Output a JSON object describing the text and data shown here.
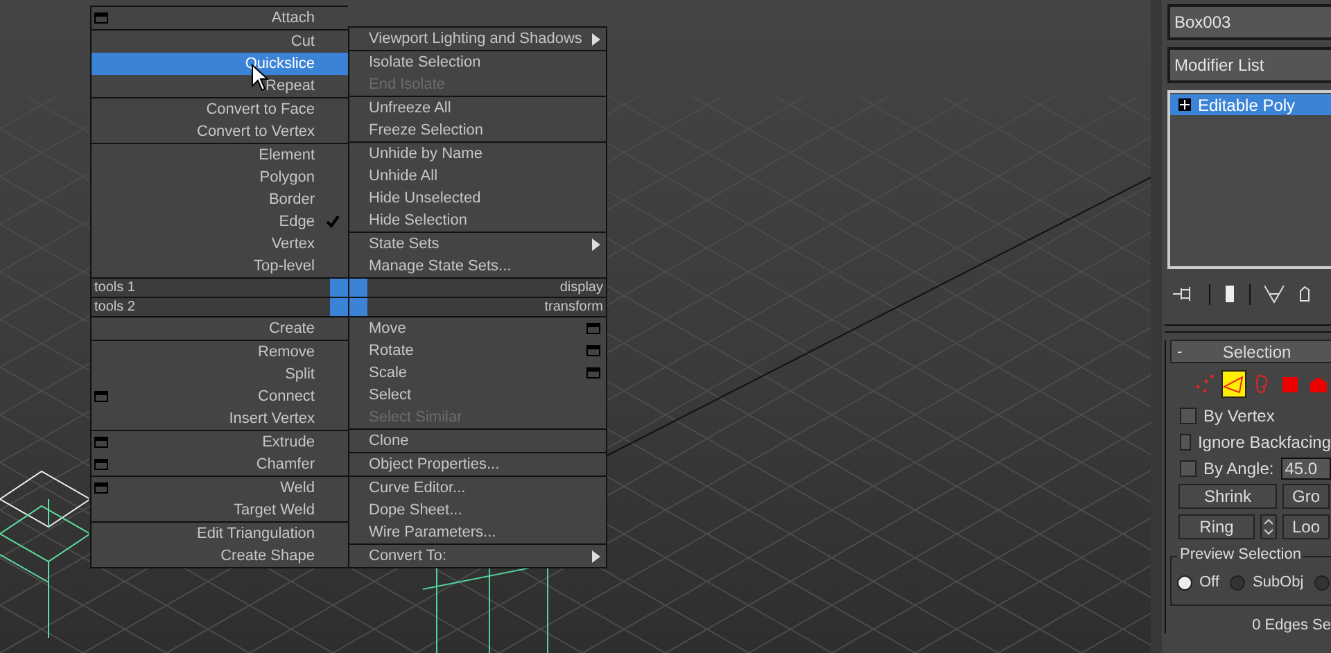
{
  "quad_menu": {
    "left": {
      "top_groups": [
        [
          {
            "label": "Attach",
            "kind": "options",
            "selected": false,
            "disabled": false,
            "checked": false
          }
        ],
        [
          {
            "label": "Cut",
            "kind": "command",
            "selected": false,
            "disabled": false,
            "checked": false
          },
          {
            "label": "Quickslice",
            "kind": "command",
            "selected": true,
            "disabled": false,
            "checked": false
          },
          {
            "label": "Repeat",
            "kind": "command",
            "selected": false,
            "disabled": false,
            "checked": false
          }
        ],
        [
          {
            "label": "Convert to Face",
            "kind": "command",
            "selected": false,
            "disabled": false,
            "checked": false
          },
          {
            "label": "Convert to Vertex",
            "kind": "command",
            "selected": false,
            "disabled": false,
            "checked": false
          }
        ],
        [
          {
            "label": "Element",
            "kind": "command",
            "selected": false,
            "disabled": false,
            "checked": false
          },
          {
            "label": "Polygon",
            "kind": "command",
            "selected": false,
            "disabled": false,
            "checked": false
          },
          {
            "label": "Border",
            "kind": "command",
            "selected": false,
            "disabled": false,
            "checked": false
          },
          {
            "label": "Edge",
            "kind": "command",
            "selected": false,
            "disabled": false,
            "checked": true
          },
          {
            "label": "Vertex",
            "kind": "command",
            "selected": false,
            "disabled": false,
            "checked": false
          },
          {
            "label": "Top-level",
            "kind": "command",
            "selected": false,
            "disabled": false,
            "checked": false
          }
        ]
      ],
      "headers": [
        {
          "label": "tools 1"
        },
        {
          "label": "tools 2"
        }
      ],
      "bottom_groups": [
        [
          {
            "label": "Create",
            "kind": "command",
            "selected": false,
            "disabled": false,
            "checked": false
          }
        ],
        [
          {
            "label": "Remove",
            "kind": "command",
            "selected": false,
            "disabled": false,
            "checked": false
          },
          {
            "label": "Split",
            "kind": "command",
            "selected": false,
            "disabled": false,
            "checked": false
          },
          {
            "label": "Connect",
            "kind": "options",
            "selected": false,
            "disabled": false,
            "checked": false
          },
          {
            "label": "Insert Vertex",
            "kind": "command",
            "selected": false,
            "disabled": false,
            "checked": false
          }
        ],
        [
          {
            "label": "Extrude",
            "kind": "options",
            "selected": false,
            "disabled": false,
            "checked": false
          },
          {
            "label": "Chamfer",
            "kind": "options",
            "selected": false,
            "disabled": false,
            "checked": false
          }
        ],
        [
          {
            "label": "Weld",
            "kind": "options",
            "selected": false,
            "disabled": false,
            "checked": false
          },
          {
            "label": "Target Weld",
            "kind": "command",
            "selected": false,
            "disabled": false,
            "checked": false
          }
        ],
        [
          {
            "label": "Edit Triangulation",
            "kind": "command",
            "selected": false,
            "disabled": false,
            "checked": false
          },
          {
            "label": "Create Shape",
            "kind": "command",
            "selected": false,
            "disabled": false,
            "checked": false
          }
        ]
      ]
    },
    "right": {
      "top_groups": [
        [
          {
            "label": "Viewport Lighting and Shadows",
            "kind": "submenu",
            "selected": false,
            "disabled": false
          }
        ],
        [
          {
            "label": "Isolate Selection",
            "kind": "command",
            "selected": false,
            "disabled": false
          },
          {
            "label": "End Isolate",
            "kind": "command",
            "selected": false,
            "disabled": true
          }
        ],
        [
          {
            "label": "Unfreeze All",
            "kind": "command",
            "selected": false,
            "disabled": false
          },
          {
            "label": "Freeze Selection",
            "kind": "command",
            "selected": false,
            "disabled": false
          }
        ],
        [
          {
            "label": "Unhide by Name",
            "kind": "command",
            "selected": false,
            "disabled": false
          },
          {
            "label": "Unhide All",
            "kind": "command",
            "selected": false,
            "disabled": false
          },
          {
            "label": "Hide Unselected",
            "kind": "command",
            "selected": false,
            "disabled": false
          },
          {
            "label": "Hide Selection",
            "kind": "command",
            "selected": false,
            "disabled": false
          }
        ],
        [
          {
            "label": "State Sets",
            "kind": "submenu",
            "selected": false,
            "disabled": false
          },
          {
            "label": "Manage State Sets...",
            "kind": "command",
            "selected": false,
            "disabled": false
          }
        ]
      ],
      "headers": [
        {
          "label": "display"
        },
        {
          "label": "transform"
        }
      ],
      "bottom_groups": [
        [
          {
            "label": "Move",
            "kind": "options",
            "selected": false,
            "disabled": false
          },
          {
            "label": "Rotate",
            "kind": "options",
            "selected": false,
            "disabled": false
          },
          {
            "label": "Scale",
            "kind": "options",
            "selected": false,
            "disabled": false
          },
          {
            "label": "Select",
            "kind": "command",
            "selected": false,
            "disabled": false
          },
          {
            "label": "Select Similar",
            "kind": "command",
            "selected": false,
            "disabled": true
          }
        ],
        [
          {
            "label": "Clone",
            "kind": "command",
            "selected": false,
            "disabled": false
          }
        ],
        [
          {
            "label": "Object Properties...",
            "kind": "command",
            "selected": false,
            "disabled": false
          }
        ],
        [
          {
            "label": "Curve Editor...",
            "kind": "command",
            "selected": false,
            "disabled": false
          },
          {
            "label": "Dope Sheet...",
            "kind": "command",
            "selected": false,
            "disabled": false
          },
          {
            "label": "Wire Parameters...",
            "kind": "command",
            "selected": false,
            "disabled": false
          }
        ],
        [
          {
            "label": "Convert To:",
            "kind": "submenu",
            "selected": false,
            "disabled": false
          }
        ]
      ]
    }
  },
  "command_panel": {
    "object_name": "Box003",
    "modifier_list": "Modifier List",
    "stack": [
      {
        "label": "Editable Poly",
        "selected": true
      }
    ],
    "selection": {
      "title": "Selection",
      "collapse": "-",
      "levels": [
        {
          "kind": "vertex",
          "selected": false
        },
        {
          "kind": "edge",
          "selected": true
        },
        {
          "kind": "border",
          "selected": false
        },
        {
          "kind": "polygon",
          "selected": false
        },
        {
          "kind": "element",
          "selected": false
        }
      ],
      "checkboxes": [
        {
          "label": "By Vertex",
          "checked": false
        },
        {
          "label": "Ignore Backfacing",
          "checked": false
        },
        {
          "label": "By Angle:",
          "checked": false
        }
      ],
      "angle_value": "45.0",
      "buttons": [
        {
          "label": "Shrink",
          "kind": "button"
        },
        {
          "label": "Gro",
          "kind": "button"
        },
        {
          "label": "Ring",
          "kind": "button"
        },
        {
          "kind": "spinner"
        },
        {
          "label": "Loo",
          "kind": "button"
        }
      ],
      "preview": {
        "title": "Preview Selection",
        "options": [
          {
            "label": "Off",
            "selected": true
          },
          {
            "label": "SubObj",
            "selected": false
          },
          {
            "selected": false
          }
        ]
      },
      "status": "0 Edges Se"
    }
  }
}
